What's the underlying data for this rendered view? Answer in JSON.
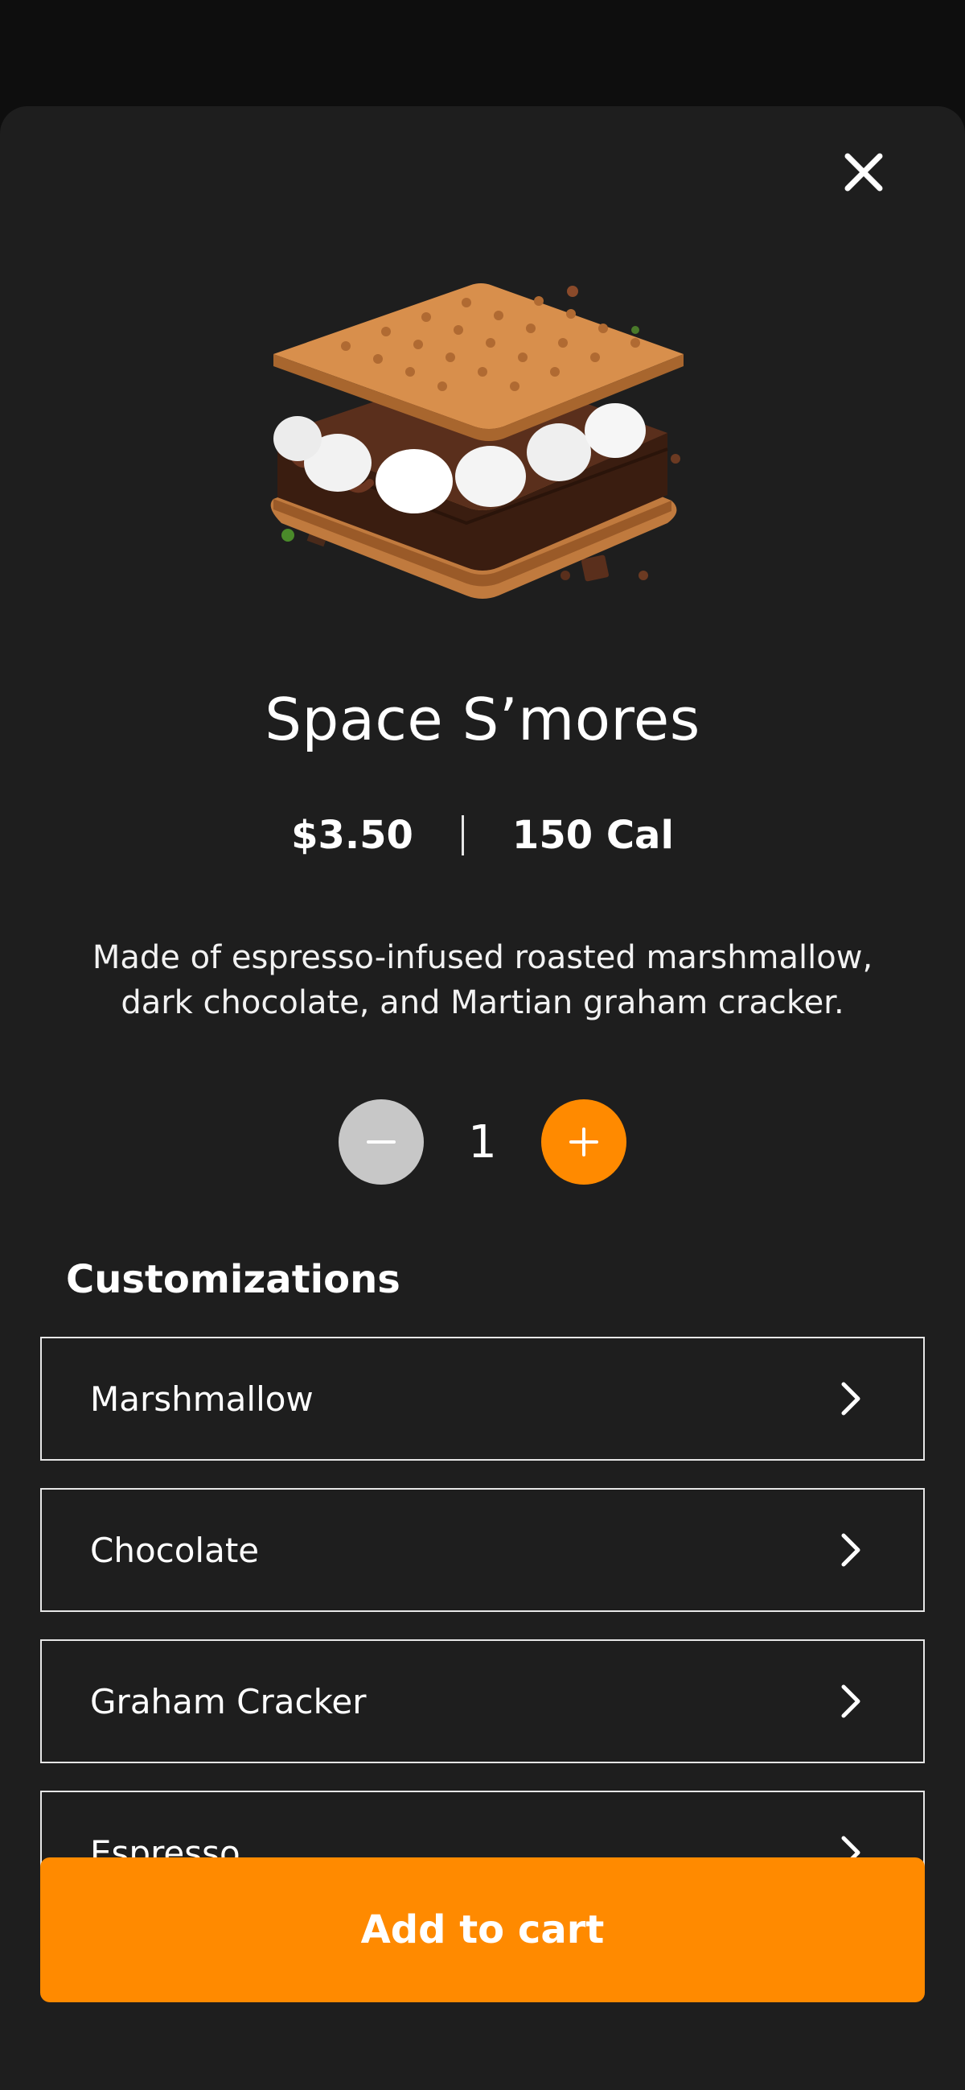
{
  "product": {
    "title": "Space S’mores",
    "price": "$3.50",
    "calories": "150 Cal",
    "description": "Made of espresso-infused roasted marshmallow, dark chocolate, and Martian graham cracker.",
    "image_icon": "smores-image"
  },
  "quantity": {
    "value": "1",
    "minus_icon": "minus-icon",
    "plus_icon": "plus-icon"
  },
  "customizations": {
    "title": "Customizations",
    "items": [
      {
        "label": "Marshmallow"
      },
      {
        "label": "Chocolate"
      },
      {
        "label": "Graham Cracker"
      },
      {
        "label": "Espresso"
      }
    ]
  },
  "actions": {
    "add_to_cart_label": "Add to cart",
    "close_icon": "close-icon"
  },
  "colors": {
    "accent": "#ff8a00",
    "sheet_bg": "#1e1e1e",
    "page_bg": "#0e0e0e",
    "minus_bg": "#c7c7c7"
  }
}
